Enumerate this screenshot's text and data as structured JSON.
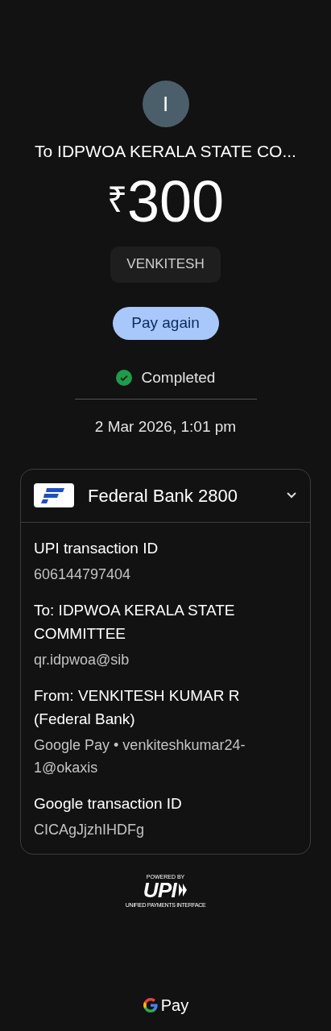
{
  "avatar": {
    "initial": "I"
  },
  "title": "To IDPWOA KERALA STATE CO...",
  "amount": {
    "currency": "₹",
    "value": "300"
  },
  "note": "VENKITESH",
  "pay_again_button": "Pay again",
  "status": {
    "label": "Completed",
    "completed": true
  },
  "date": "2 Mar 2026, 1:01 pm",
  "account_card": {
    "bank": "Federal Bank 2800",
    "expanded": true,
    "details": [
      {
        "label": "UPI transaction ID",
        "value": "606144797404"
      },
      {
        "label": "To: IDPWOA KERALA STATE COMMITTEE",
        "value": "qr.idpwoa@sib"
      },
      {
        "label": "From: VENKITESH KUMAR R (Federal Bank)",
        "value": "Google Pay • venkiteshkumar24-1@okaxis"
      },
      {
        "label": "Google transaction ID",
        "value": "CICAgJjzhIHDFg"
      }
    ]
  },
  "upi_badge": {
    "caption": "POWERED BY",
    "logo": "UPI",
    "tagline": "UNIFIED PAYMENTS INTERFACE"
  },
  "footer_brand": "Pay"
}
